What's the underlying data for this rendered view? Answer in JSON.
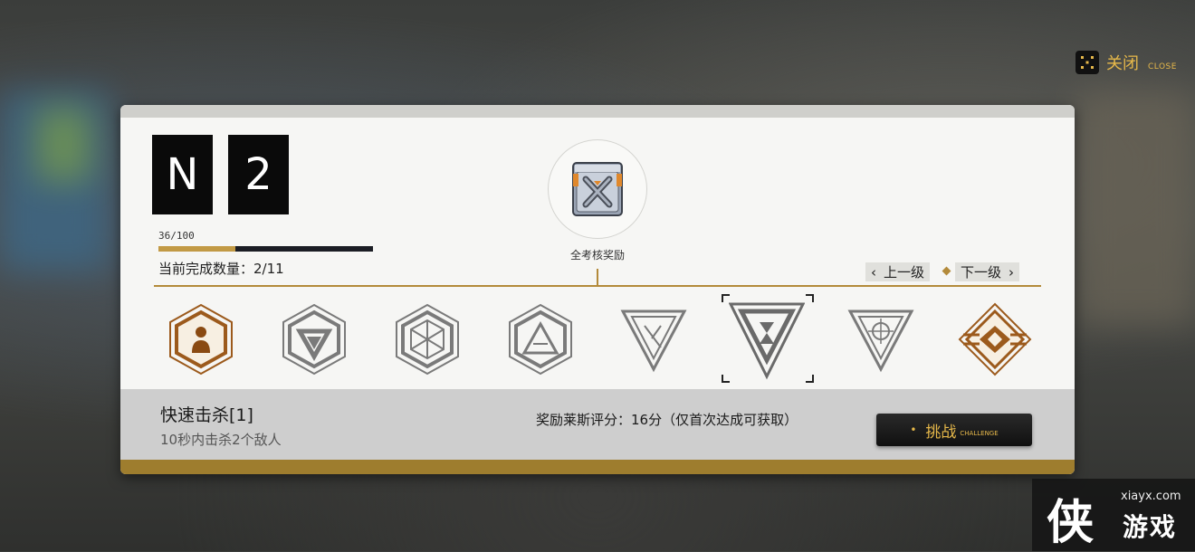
{
  "close": {
    "label": "关闭",
    "sub": "CLOSE"
  },
  "rank": {
    "letter": "N",
    "level": "2"
  },
  "progress": {
    "text": "36/100",
    "value": 0.36
  },
  "completed": "当前完成数量：2/11",
  "reward": {
    "label": "全考核奖励",
    "icon": "supply-crate-icon"
  },
  "nav": {
    "prev": "上一级",
    "next": "下一级"
  },
  "badges": [
    {
      "name": "person-hex-badge",
      "state": "active"
    },
    {
      "name": "triangle-hex-badge",
      "state": "inactive"
    },
    {
      "name": "cube-hex-badge",
      "state": "inactive"
    },
    {
      "name": "pyramid-hex-badge",
      "state": "inactive"
    },
    {
      "name": "cross-triangle-badge",
      "state": "inactive"
    },
    {
      "name": "hourglass-triangle-badge",
      "state": "selected"
    },
    {
      "name": "crosshair-triangle-badge",
      "state": "inactive"
    },
    {
      "name": "diamond-badge",
      "state": "active"
    }
  ],
  "task": {
    "title": "快速击杀[1]",
    "desc": "10秒内击杀2个敌人"
  },
  "reward_desc": "奖励莱斯评分：16分（仅首次达成可获取）",
  "challenge": {
    "label": "挑战",
    "sub": "CHALLENGE"
  },
  "watermark": {
    "logo": "侠",
    "url": "xiayx.com",
    "name": "游戏"
  },
  "colors": {
    "accent": "#b38a3a",
    "badge_active": "#9c5a1c",
    "badge_inactive": "#7a7a7a"
  }
}
